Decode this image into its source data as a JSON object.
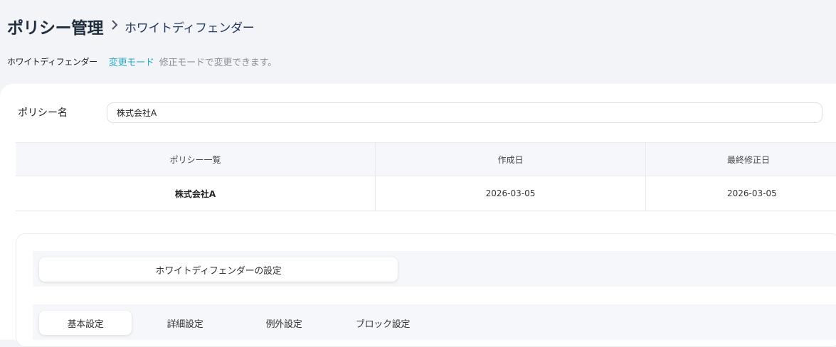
{
  "header": {
    "title": "ポリシー管理",
    "breadcrumb_separator": "›",
    "breadcrumb_current": "ホワイトディフェンダー",
    "mode_name": "ホワイトディフェンダー",
    "mode_link": "変更モード",
    "mode_description": "修正モードで変更できます。"
  },
  "form": {
    "policy_name_label": "ポリシー名",
    "policy_name_value": "株式会社A"
  },
  "table": {
    "headers": [
      "ポリシー一覧",
      "作成日",
      "最終修正日"
    ],
    "rows": [
      [
        "株式会社A",
        "2026-03-05",
        "2026-03-05"
      ]
    ]
  },
  "settings": {
    "section_title": "ホワイトディフェンダーの設定",
    "tabs": [
      {
        "label": "基本設定",
        "active": true
      },
      {
        "label": "詳細設定",
        "active": false
      },
      {
        "label": "例外設定",
        "active": false
      },
      {
        "label": "ブロック設定",
        "active": false
      }
    ]
  },
  "icons": {
    "breadcrumb_separator": "chevron-right-icon"
  },
  "colors": {
    "accent_link": "#2aa9c4",
    "title": "#1f2d3d",
    "background": "#f3f4f8"
  }
}
